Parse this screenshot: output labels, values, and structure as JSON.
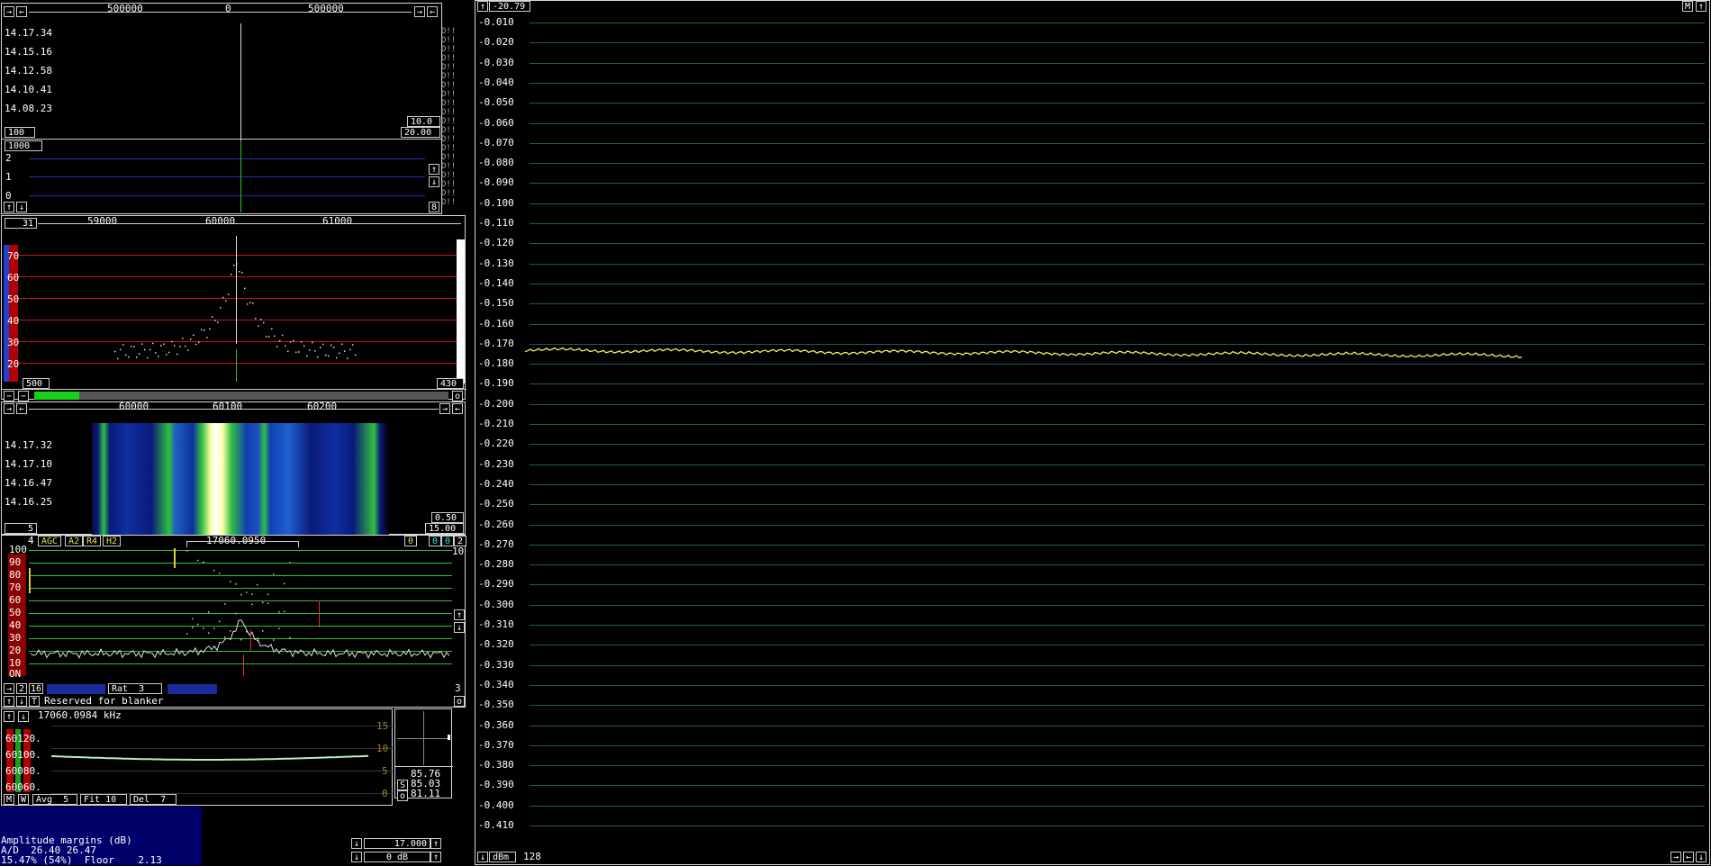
{
  "wide_graph": {
    "scale": [
      "500000",
      "0",
      "500000"
    ],
    "times": [
      "14.17.34",
      "14.15.16",
      "14.12.58",
      "14.10.41",
      "14.08.23"
    ],
    "marks": [
      "D!!",
      "D!!",
      "D!!",
      "D!!",
      "D!!",
      "D!!",
      "D!!",
      "D!!",
      "D!!",
      "D!!",
      "D!!",
      "D!!",
      "D!!",
      "D!!",
      "D!!",
      "D!!",
      "D!!",
      "D!!",
      "D!!",
      "D!!"
    ],
    "box_100": "100",
    "box_10": "10.0",
    "box_2000": "20.00",
    "box_1000": "1000",
    "levels": [
      "2",
      "1",
      "0"
    ],
    "btn_8": "8"
  },
  "hires": {
    "box_31": "31",
    "scale": [
      "59000",
      "60000",
      "61000"
    ],
    "y": [
      "70",
      "60",
      "50",
      "40",
      "30",
      "20"
    ],
    "box_500": "500",
    "box_430": "430"
  },
  "waterfall": {
    "scale": [
      "60000",
      "60100",
      "60200"
    ],
    "times": [
      "14.17.32",
      "14.17.10",
      "14.16.47",
      "14.16.25"
    ],
    "box_5": "5",
    "box_050": "0.50",
    "box_1500": "15.00"
  },
  "baseband": {
    "num_4": "4",
    "mode_buttons": [
      "AGC",
      "A2",
      "R4",
      "H2"
    ],
    "freq": "17060.0950",
    "right_0": "0",
    "right_0b": "0",
    "right_0c": "0",
    "right_2": "2",
    "side_10": "10",
    "y": [
      "100",
      "90",
      "80",
      "70",
      "60",
      "50",
      "40",
      "30",
      "20",
      "10"
    ],
    "on": "ON",
    "bw_btns": [
      "2",
      "16"
    ],
    "rat": "Rat  3",
    "right_3": "3",
    "reserved": "Reserved for blanker"
  },
  "freq_panel": {
    "freq": "17060.0984 kHz",
    "y": [
      "60120.",
      "60100.",
      "60080.",
      "60060."
    ],
    "right_y": [
      "15",
      "10",
      "5",
      "0"
    ],
    "avg": "Avg  5",
    "fit": "Fit 10",
    "del": "Del  7",
    "m": "M",
    "w": "W",
    "s_label": "S",
    "o_label": "o",
    "vals": [
      "85.76",
      "85.03",
      "81.11"
    ]
  },
  "amp": {
    "title": "Amplitude margins (dB)",
    "line2": "A/D  26.40 26.47",
    "line3": "15.47% (54%)  Floor    2.13"
  },
  "ctl": {
    "v1": "17.000",
    "v2": "0 dB"
  },
  "afc": {
    "top_val": "-20.79",
    "m": "M",
    "y": [
      "-0.010",
      "-0.020",
      "-0.030",
      "-0.040",
      "-0.050",
      "-0.060",
      "-0.070",
      "-0.080",
      "-0.090",
      "-0.100",
      "-0.110",
      "-0.120",
      "-0.130",
      "-0.140",
      "-0.150",
      "-0.160",
      "-0.170",
      "-0.180",
      "-0.190",
      "-0.200",
      "-0.210",
      "-0.220",
      "-0.230",
      "-0.240",
      "-0.250",
      "-0.260",
      "-0.270",
      "-0.280",
      "-0.290",
      "-0.300",
      "-0.310",
      "-0.320",
      "-0.330",
      "-0.340",
      "-0.350",
      "-0.360",
      "-0.370",
      "-0.380",
      "-0.390",
      "-0.400",
      "-0.410"
    ],
    "dbm": "dBm",
    "n": "128"
  },
  "colors": {
    "trace": "#f2ef5a",
    "grid_afc": "#1f5a5a",
    "red_grid": "#cc1010",
    "blue_grid": "#2030b0",
    "green_grid": "#30c030"
  }
}
